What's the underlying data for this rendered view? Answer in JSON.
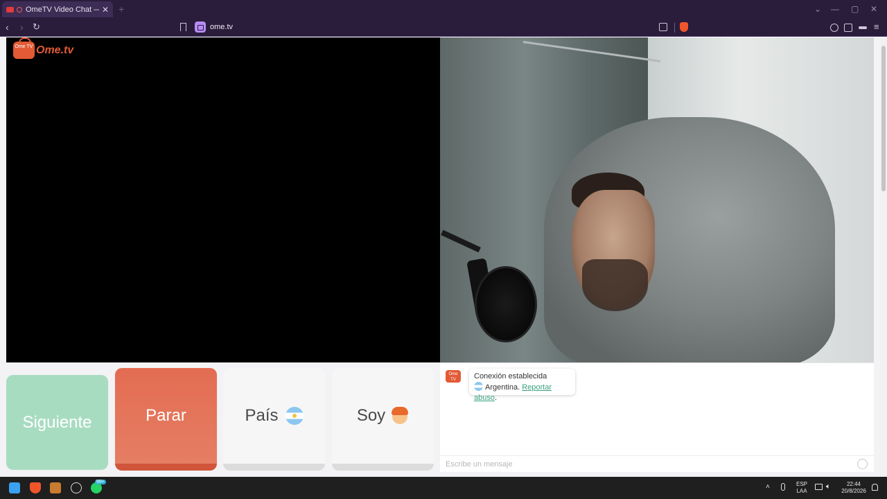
{
  "browser": {
    "tab_title": "OmeTV Video Chat — Omeg",
    "tab_close": "✕",
    "new_tab": "+",
    "url": "ome.tv",
    "win_min": "—",
    "win_max": "▢",
    "win_close": "✕",
    "win_down": "⌄"
  },
  "page": {
    "logo_word": "Ome.tv",
    "logo_badge": "Ome TV"
  },
  "buttons": {
    "next": "Siguiente",
    "stop": "Parar",
    "country": "País",
    "gender": "Soy"
  },
  "chat": {
    "logo_badge": "Ome TV",
    "status": "Conexión establecida",
    "country": "Argentina.",
    "report": "Reportar abuso",
    "report_suffix": ".",
    "input_placeholder": "Escribe un mensaje"
  },
  "taskbar": {
    "lang_top": "ESP",
    "lang_bottom": "LAA",
    "time": "22:44",
    "date": "20/8/2026",
    "badge": "99+"
  },
  "colors": {
    "accent": "#e25a36",
    "next_button": "#a8dcc1",
    "link": "#3aa17e",
    "browser_chrome": "#2a1c3b"
  }
}
